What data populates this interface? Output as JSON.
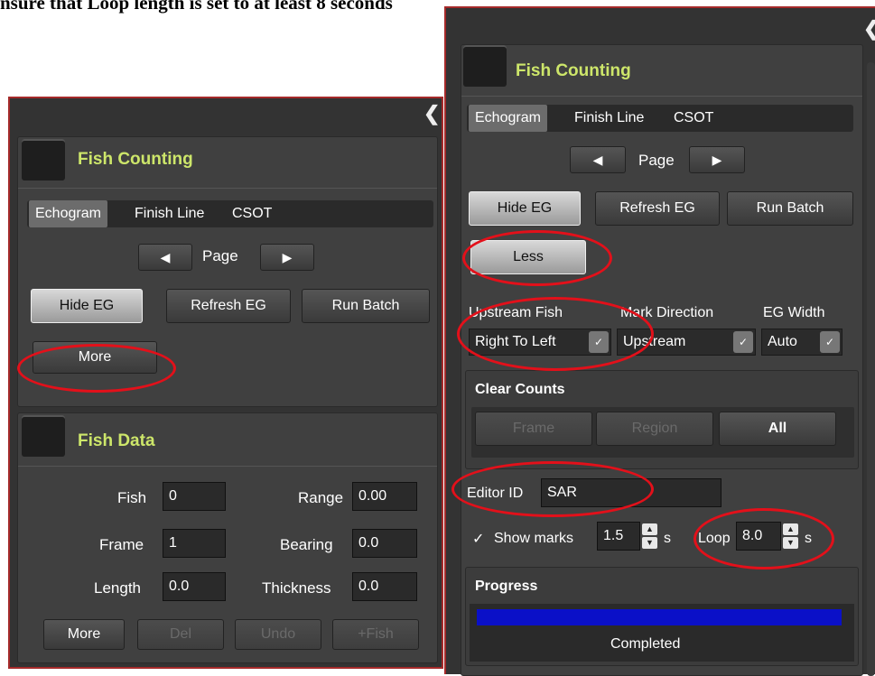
{
  "caption": "nsure that Loop length is set to at least 8 seconds",
  "left_panel": {
    "collapse_icon": "chevron-left",
    "fish_counting": {
      "title": "Fish Counting",
      "tabs": [
        "Echogram",
        "Finish Line",
        "CSOT"
      ],
      "page_label": "Page",
      "hide_eg": "Hide EG",
      "refresh_eg": "Refresh EG",
      "run_batch": "Run Batch",
      "more": "More"
    },
    "fish_data": {
      "title": "Fish Data",
      "fields": {
        "fish_label": "Fish",
        "fish_value": "0",
        "range_label": "Range",
        "range_value": "0.00",
        "frame_label": "Frame",
        "frame_value": "1",
        "bearing_label": "Bearing",
        "bearing_value": "0.0",
        "length_label": "Length",
        "length_value": "0.0",
        "thickness_label": "Thickness",
        "thickness_value": "0.0"
      },
      "buttons": {
        "more": "More",
        "del": "Del",
        "undo": "Undo",
        "add_fish": "+Fish"
      }
    }
  },
  "right_panel": {
    "collapse_icon": "chevron-left",
    "fish_counting": {
      "title": "Fish Counting",
      "tabs": [
        "Echogram",
        "Finish Line",
        "CSOT"
      ],
      "page_label": "Page",
      "hide_eg": "Hide EG",
      "refresh_eg": "Refresh EG",
      "run_batch": "Run Batch",
      "less": "Less",
      "upstream_fish_label": "Upstream Fish",
      "upstream_fish_value": "Right To Left",
      "mark_direction_label": "Mark Direction",
      "mark_direction_value": "Upstream",
      "eg_width_label": "EG Width",
      "eg_width_value": "Auto",
      "clear_counts": {
        "title": "Clear Counts",
        "frame": "Frame",
        "region": "Region",
        "all": "All"
      },
      "editor_id_label": "Editor ID",
      "editor_id_value": "SAR",
      "show_marks_label": "Show marks",
      "show_marks_checked": true,
      "show_marks_value": "1.5",
      "show_marks_unit": "s",
      "loop_label": "Loop",
      "loop_value": "8.0",
      "loop_unit": "s",
      "progress": {
        "title": "Progress",
        "fraction": 1.0,
        "status": "Completed"
      }
    }
  },
  "colors": {
    "panel_bg": "#333333",
    "section_title": "#cde66a",
    "highlight_oval": "#e3101a",
    "progress_fill": "#0a10c8",
    "panel_border": "#a52a2a"
  }
}
